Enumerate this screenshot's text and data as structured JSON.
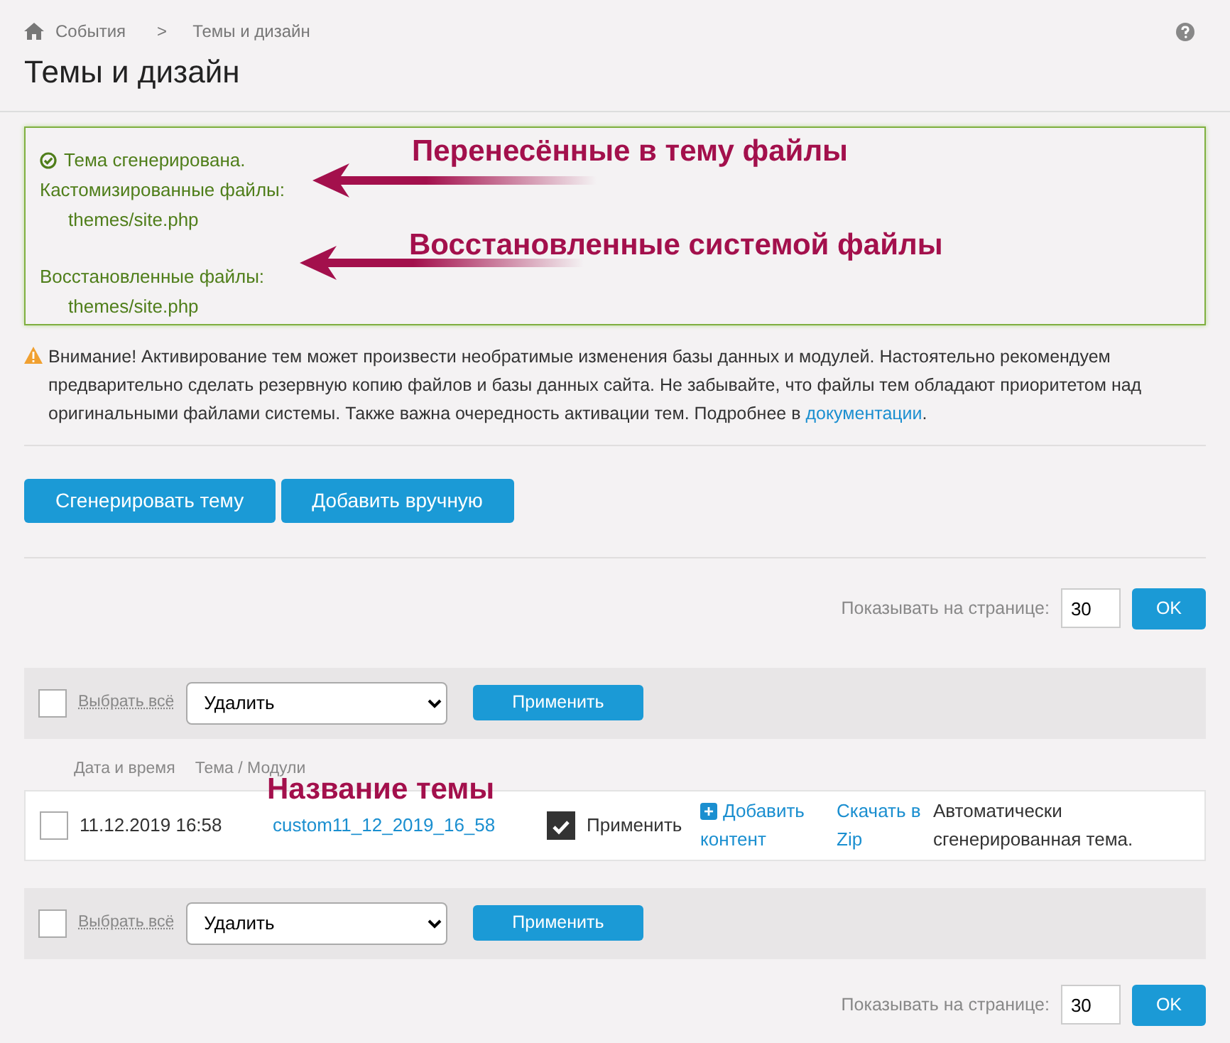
{
  "breadcrumb": [
    {
      "label": "События"
    },
    {
      "label": "Темы и дизайн"
    }
  ],
  "breadcrumb_separator": ">",
  "title": "Темы и дизайн",
  "result": {
    "status": "Тема сгенерирована.",
    "sections": [
      {
        "label": "Кастомизированные файлы:",
        "files": [
          "themes/site.php"
        ]
      },
      {
        "label": "Восстановленные файлы:",
        "files": [
          "themes/site.php"
        ]
      }
    ]
  },
  "annotations": [
    {
      "text": "Перенесённые в тему файлы"
    },
    {
      "text": "Восстановленные системой файлы"
    },
    {
      "text": "Название темы"
    }
  ],
  "warning": {
    "text": "Внимание! Активирование тем может произвести необратимые изменения базы данных и модулей. Настоятельно рекомендуем предварительно сделать резервную копию файлов и базы данных сайта. Не забывайте, что файлы тем обладают приоритетом над оригинальными файлами системы. Также важна очередность активации тем. Подробнее в",
    "link": "документации",
    "after": "."
  },
  "buttons": [
    "Сгенерировать тему",
    "Добавить вручную"
  ],
  "pager_top": {
    "label": "Показывать на странице:",
    "value": "30",
    "button": "OK"
  },
  "bulk_top": {
    "select_all": "Выбрать всё",
    "checked": false,
    "action": "Удалить",
    "apply": "Применить"
  },
  "table": {
    "columns": [
      "Дата и время",
      "Тема / Модули"
    ],
    "rows": [
      {
        "checked": false,
        "date": "11.12.2019 16:58",
        "name": "custom11_12_2019_16_58",
        "apply_checked": true,
        "apply_label": "Применить",
        "add_content": "Добавить контент",
        "add_icon": "+",
        "download": "Скачать в Zip",
        "description": "Автоматически сгенерированная тема."
      }
    ]
  },
  "bulk_bottom": {
    "select_all": "Выбрать всё",
    "checked": false,
    "action": "Удалить",
    "apply": "Применить"
  },
  "pager_bottom": {
    "label": "Показывать на странице:",
    "value": "30",
    "button": "OK"
  }
}
